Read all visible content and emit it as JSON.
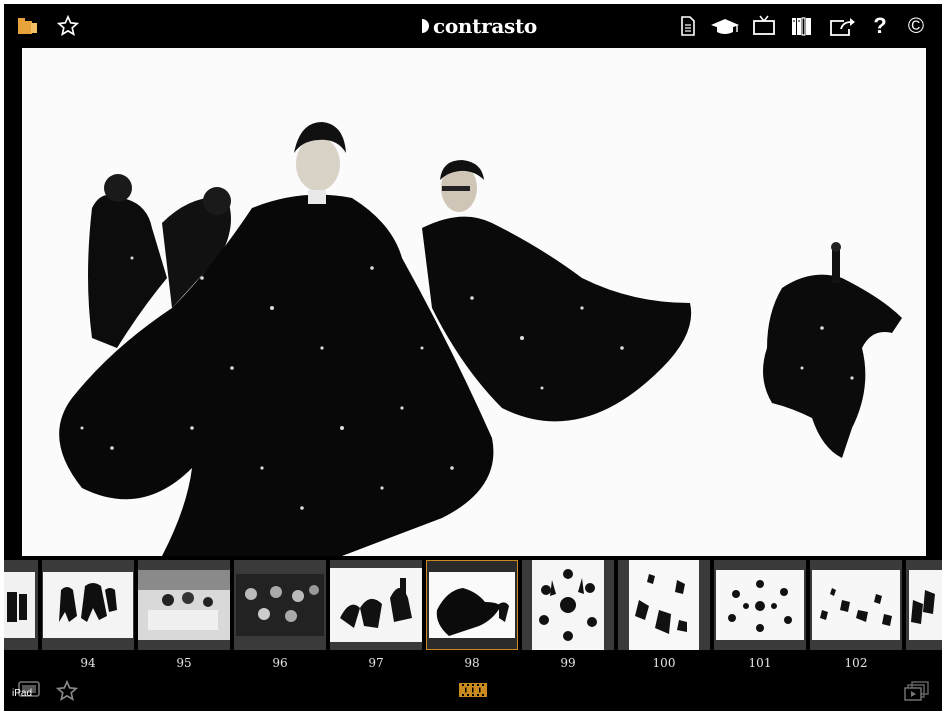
{
  "app": {
    "brand": "contrasto",
    "device_badge": "iPad"
  },
  "topbar": {
    "left_icons": [
      "folder-icon",
      "favorite-star-icon"
    ],
    "right_icons": [
      "document-icon",
      "graduation-cap-icon",
      "tv-icon",
      "library-books-icon",
      "share-icon",
      "help-icon",
      "copyright-icon"
    ],
    "help_glyph": "?",
    "copyright_glyph": "©"
  },
  "filmstrip": {
    "selected": "98",
    "items": [
      {
        "num": ""
      },
      {
        "num": "94"
      },
      {
        "num": "95"
      },
      {
        "num": "96"
      },
      {
        "num": "97"
      },
      {
        "num": "98"
      },
      {
        "num": "99"
      },
      {
        "num": "100"
      },
      {
        "num": "101"
      },
      {
        "num": "102"
      },
      {
        "num": ""
      }
    ]
  },
  "bottombar": {
    "icons": [
      "gallery-icon",
      "favorite-star-icon",
      "filmstrip-icon",
      "slideshow-icon"
    ]
  },
  "colors": {
    "accent": "#e8a23a",
    "selected_border": "#c98a1f",
    "background": "#000000"
  }
}
